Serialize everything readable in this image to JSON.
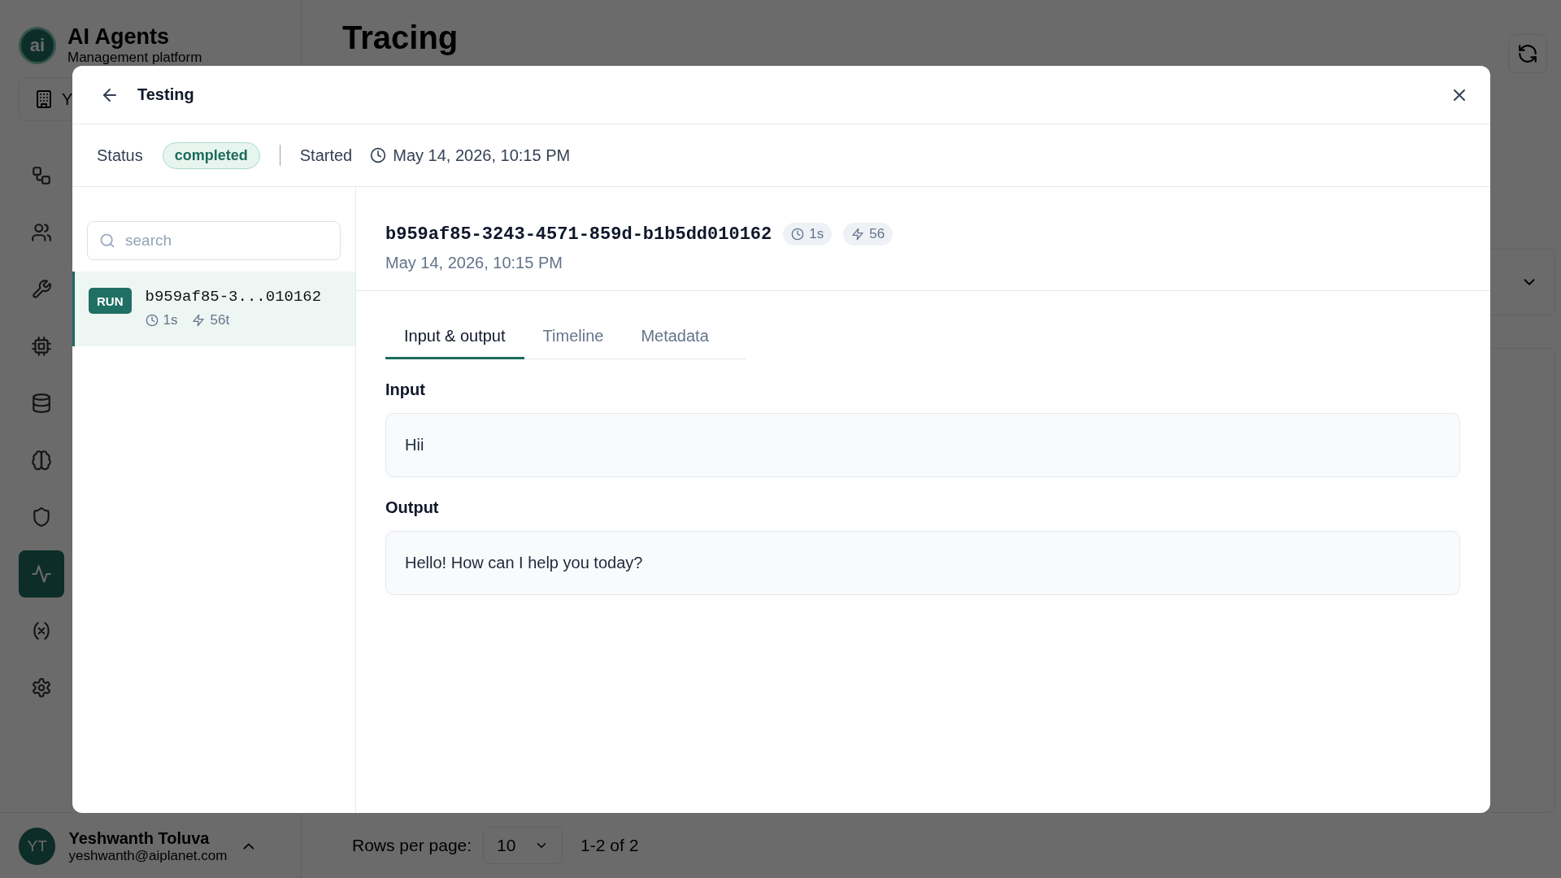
{
  "app": {
    "logo_text": "ai",
    "name": "AI Agents",
    "subtitle": "Management platform",
    "workspace": "Y",
    "nav": [
      {
        "selected": false
      },
      {
        "selected": false
      },
      {
        "selected": false
      },
      {
        "selected": false
      },
      {
        "selected": false
      },
      {
        "selected": false
      },
      {
        "selected": false
      },
      {
        "selected": true
      },
      {
        "selected": false
      },
      {
        "selected": false
      }
    ],
    "user": {
      "initials": "YT",
      "name": "Yeshwanth Toluva",
      "email": "yeshwanth@aiplanet.com"
    }
  },
  "page": {
    "title": "Tracing",
    "rows_per_page_label": "Rows per page:",
    "rows_per_page": "10",
    "range": "1-2 of 2"
  },
  "modal": {
    "title": "Testing",
    "status_label": "Status",
    "status": "completed",
    "started_label": "Started",
    "started": "May 14, 2026, 10:15 PM",
    "search": {
      "placeholder": "search"
    },
    "runs": [
      {
        "badge": "RUN",
        "id": "b959af85-3...010162",
        "duration": "1s",
        "tokens": "56t",
        "selected": true
      }
    ],
    "detail": {
      "id": "b959af85-3243-4571-859d-b1b5dd010162",
      "duration": "1s",
      "tokens": "56",
      "date": "May 14, 2026, 10:15 PM",
      "tabs": [
        {
          "label": "Input & output",
          "selected": true
        },
        {
          "label": "Timeline",
          "selected": false
        },
        {
          "label": "Metadata",
          "selected": false
        }
      ],
      "sections": [
        {
          "label": "Input",
          "text": "Hii"
        },
        {
          "label": "Output",
          "text": "Hello! How can I help you today?"
        }
      ]
    }
  }
}
